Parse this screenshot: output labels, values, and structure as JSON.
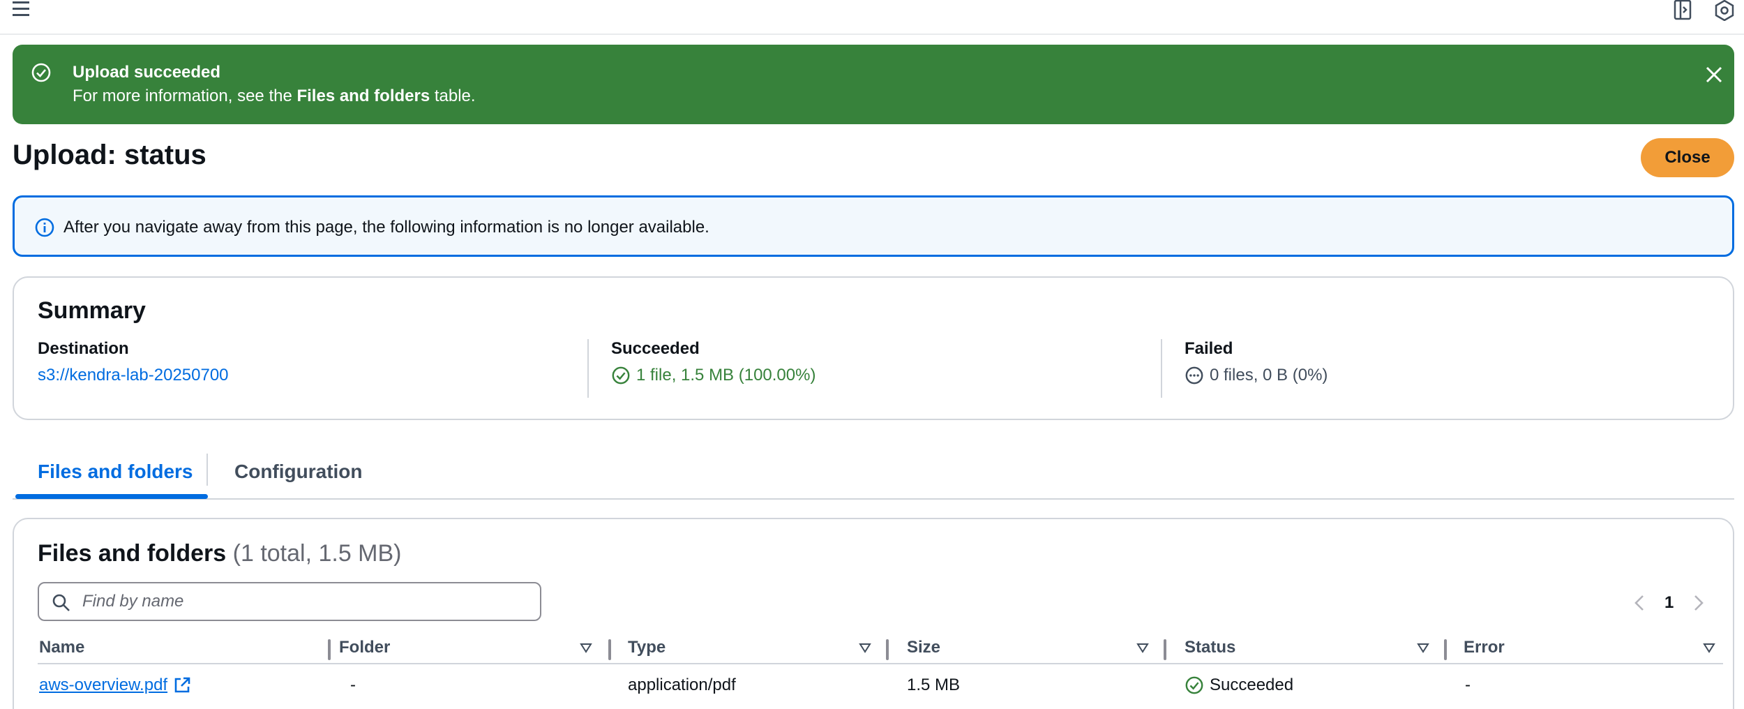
{
  "colors": {
    "flash_success_bg": "#37823b",
    "primary_button": "#f29d38",
    "link_blue": "#006ce0",
    "info_bg": "#f2f8fd",
    "success_text": "#37823b"
  },
  "topbar": {
    "menu_icon": "hamburger-menu-icon",
    "right_icons": [
      "side-panel-icon",
      "settings-hexagon-icon"
    ]
  },
  "flash": {
    "title": "Upload succeeded",
    "message_prefix": "For more information, see the ",
    "message_bold": "Files and folders",
    "message_suffix": " table.",
    "icon": "check-circle-icon",
    "dismiss_icon": "close-icon"
  },
  "page": {
    "title": "Upload: status",
    "close_label": "Close"
  },
  "info": {
    "text": "After you navigate away from this page, the following information is no longer available.",
    "icon": "info-circle-icon"
  },
  "summary": {
    "heading": "Summary",
    "destination": {
      "label": "Destination",
      "value": "s3://kendra-lab-20250700"
    },
    "succeeded": {
      "label": "Succeeded",
      "value": "1 file, 1.5 MB (100.00%)"
    },
    "failed": {
      "label": "Failed",
      "value": "0 files, 0 B (0%)"
    }
  },
  "tabs": [
    {
      "label": "Files and folders",
      "active": true
    },
    {
      "label": "Configuration",
      "active": false
    }
  ],
  "files": {
    "heading": "Files and folders",
    "count": "(1 total, 1.5 MB)",
    "search_placeholder": "Find by name",
    "page": "1",
    "columns": [
      "Name",
      "Folder",
      "Type",
      "Size",
      "Status",
      "Error"
    ],
    "rows": [
      {
        "name": "aws-overview.pdf",
        "folder": "-",
        "type": "application/pdf",
        "size": "1.5 MB",
        "status": "Succeeded",
        "error": "-"
      }
    ]
  }
}
